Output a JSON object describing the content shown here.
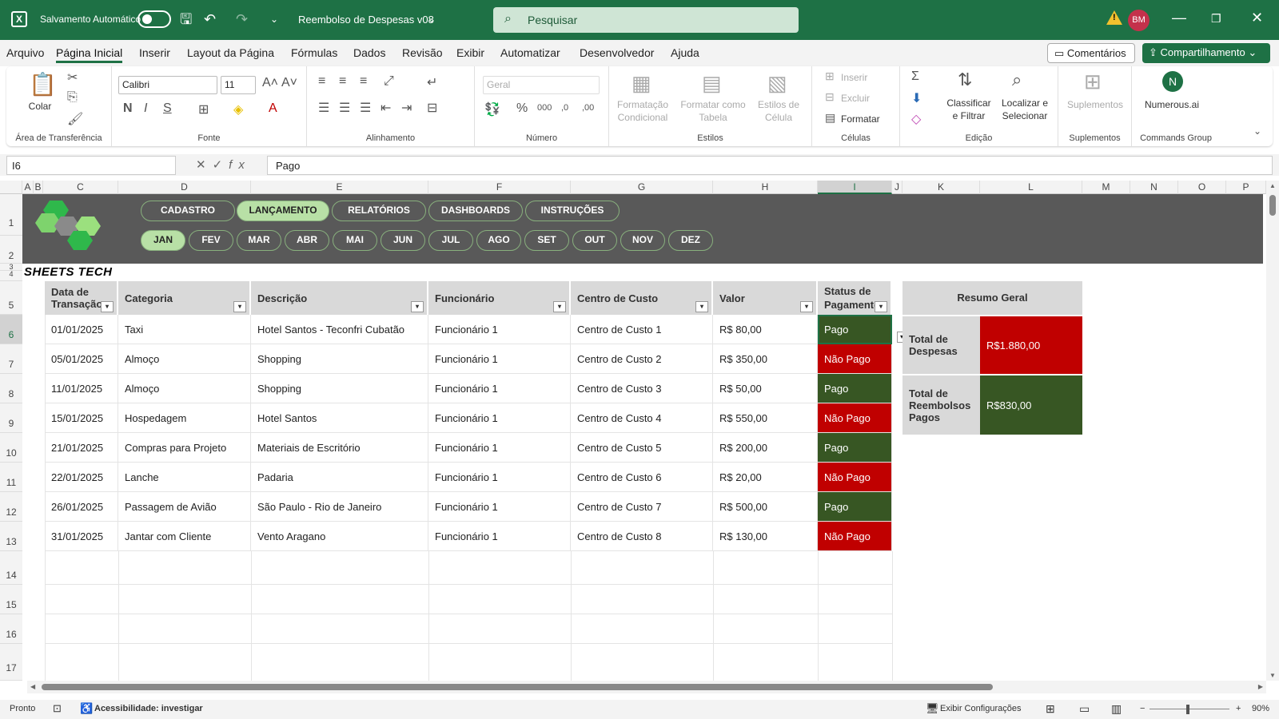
{
  "titlebar": {
    "autosave_label": "Salvamento Automático",
    "document_name": "Reembolso de Despesas v08",
    "search_placeholder": "Pesquisar",
    "avatar_initials": "BM"
  },
  "menu": {
    "items": [
      "Arquivo",
      "Página Inicial",
      "Inserir",
      "Layout da Página",
      "Fórmulas",
      "Dados",
      "Revisão",
      "Exibir",
      "Automatizar",
      "Desenvolvedor",
      "Ajuda"
    ],
    "active": "Página Inicial",
    "comments_label": "Comentários",
    "share_label": "Compartilhamento"
  },
  "ribbon": {
    "clipboard": {
      "paste": "Colar",
      "group": "Área de Transferência"
    },
    "font": {
      "name": "Calibri",
      "size": "11",
      "group": "Fonte"
    },
    "alignment": {
      "group": "Alinhamento"
    },
    "number": {
      "format": "Geral",
      "group": "Número"
    },
    "styles": {
      "conditional": "Formatação Condicional",
      "table": "Formatar como Tabela",
      "cell_styles": "Estilos de Célula",
      "group": "Estilos"
    },
    "cells": {
      "insert": "Inserir",
      "delete": "Excluir",
      "format": "Formatar",
      "group": "Células"
    },
    "editing": {
      "sort": "Classificar e Filtrar",
      "find": "Localizar e Selecionar",
      "group": "Edição"
    },
    "addins": {
      "label": "Suplementos",
      "group": "Suplementos"
    },
    "commands": {
      "label": "Numerous.ai",
      "group": "Commands Group"
    }
  },
  "formula_bar": {
    "cell_ref": "I6",
    "value": "Pago"
  },
  "columns": [
    "A",
    "B",
    "C",
    "D",
    "E",
    "F",
    "G",
    "H",
    "I",
    "J",
    "K",
    "L",
    "M",
    "N",
    "O",
    "P"
  ],
  "rows": [
    "1",
    "2",
    "3",
    "4",
    "5",
    "6",
    "7",
    "8",
    "9",
    "10",
    "11",
    "12",
    "13",
    "14",
    "15",
    "16",
    "17"
  ],
  "nav_tabs": [
    "CADASTRO",
    "LANÇAMENTO",
    "RELATÓRIOS",
    "DASHBOARDS",
    "INSTRUÇÕES"
  ],
  "active_nav": "LANÇAMENTO",
  "month_tabs": [
    "JAN",
    "FEV",
    "MAR",
    "ABR",
    "MAI",
    "JUN",
    "JUL",
    "AGO",
    "SET",
    "OUT",
    "NOV",
    "DEZ"
  ],
  "active_month": "JAN",
  "brand": "SHEETS TECH",
  "table": {
    "headers": [
      "Data de Transação",
      "Categoria",
      "Descrição",
      "Funcionário",
      "Centro de Custo",
      "Valor",
      "Status de Pagamento"
    ],
    "rows": [
      [
        "01/01/2025",
        "Taxi",
        "Hotel Santos - Teconfri Cubatão",
        "Funcionário 1",
        "Centro de Custo 1",
        "R$ 80,00",
        "Pago"
      ],
      [
        "05/01/2025",
        "Almoço",
        "Shopping",
        "Funcionário 1",
        "Centro de Custo 2",
        "R$ 350,00",
        "Não Pago"
      ],
      [
        "11/01/2025",
        "Almoço",
        "Shopping",
        "Funcionário 1",
        "Centro de Custo 3",
        "R$ 50,00",
        "Pago"
      ],
      [
        "15/01/2025",
        "Hospedagem",
        "Hotel Santos",
        "Funcionário 1",
        "Centro de Custo 4",
        "R$ 550,00",
        "Não Pago"
      ],
      [
        "21/01/2025",
        "Compras para Projeto",
        "Materiais de Escritório",
        "Funcionário 1",
        "Centro de Custo 5",
        "R$ 200,00",
        "Pago"
      ],
      [
        "22/01/2025",
        "Lanche",
        "Padaria",
        "Funcionário 1",
        "Centro de Custo 6",
        "R$ 20,00",
        "Não Pago"
      ],
      [
        "26/01/2025",
        "Passagem de Avião",
        "São Paulo - Rio de Janeiro",
        "Funcionário 1",
        "Centro de Custo 7",
        "R$ 500,00",
        "Pago"
      ],
      [
        "31/01/2025",
        "Jantar com Cliente",
        "Vento Aragano",
        "Funcionário 1",
        "Centro de Custo 8",
        "R$ 130,00",
        "Não Pago"
      ]
    ]
  },
  "summary": {
    "title": "Resumo Geral",
    "total_expenses_label": "Total de Despesas",
    "total_expenses_value": "R$1.880,00",
    "total_paid_label": "Total de Reembolsos Pagos",
    "total_paid_value": "R$830,00"
  },
  "colors": {
    "green": "#1e7145",
    "paid": "#375623",
    "unpaid": "#c00000",
    "banner": "#595959",
    "active_tab": "#b8e0a6"
  },
  "status": {
    "ready": "Pronto",
    "accessibility": "Acessibilidade: investigar",
    "display_settings": "Exibir Configurações",
    "zoom": "90%"
  }
}
